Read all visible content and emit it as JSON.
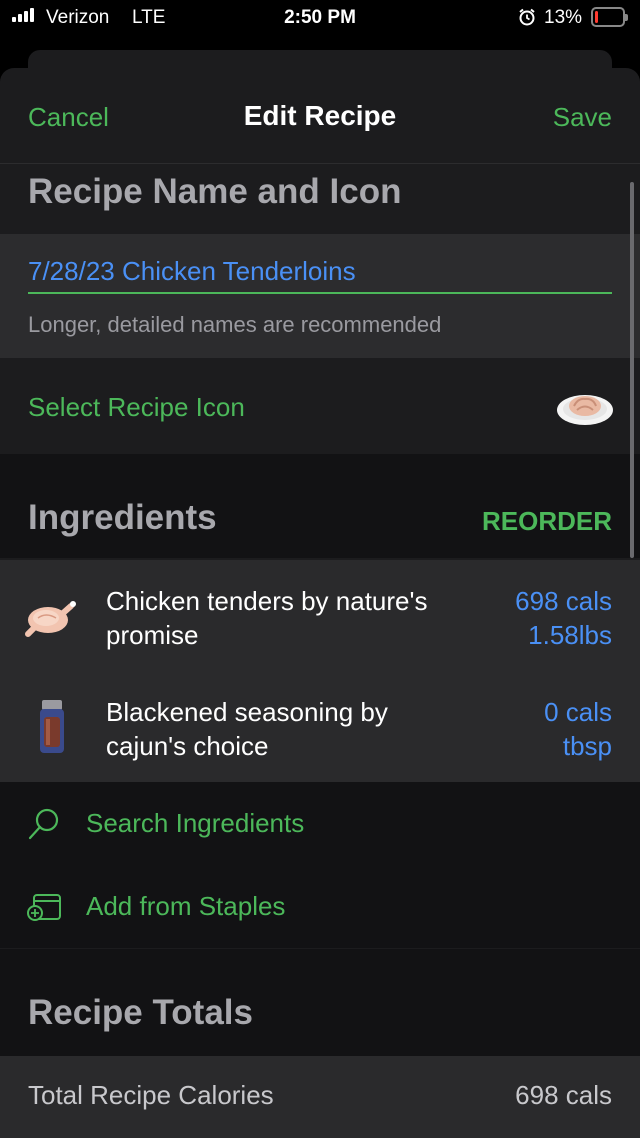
{
  "status_bar": {
    "carrier": "Verizon",
    "network": "LTE",
    "time": "2:50 PM",
    "battery_percent": "13%",
    "battery_level": 0.13,
    "alarm_icon": "alarm-clock-icon",
    "battery_color": "#ff3b30"
  },
  "nav": {
    "cancel_label": "Cancel",
    "title": "Edit Recipe",
    "save_label": "Save"
  },
  "recipe_name_section": {
    "heading": "Recipe Name and Icon",
    "name_value": "7/28/23 Chicken Tenderloins",
    "hint": "Longer, detailed names are recommended",
    "select_icon_label": "Select Recipe Icon",
    "icon": "chicken-plate-icon"
  },
  "ingredients_section": {
    "heading": "Ingredients",
    "reorder_label": "REORDER",
    "items": [
      {
        "name": "Chicken tenders by nature's promise",
        "calories": "698 cals",
        "amount": "1.58lbs",
        "icon": "roast-chicken-icon"
      },
      {
        "name": "Blackened seasoning by cajun's choice",
        "calories": "0 cals",
        "amount": "tbsp",
        "icon": "spice-jar-icon"
      }
    ],
    "actions": [
      {
        "label": "Search Ingredients",
        "icon": "search-icon"
      },
      {
        "label": "Add from Staples",
        "icon": "staples-icon"
      }
    ]
  },
  "totals_section": {
    "heading": "Recipe Totals",
    "rows": [
      {
        "label": "Total Recipe Calories",
        "value": "698 cals"
      }
    ]
  },
  "colors": {
    "accent_green": "#4cb85a",
    "link_blue": "#4a90f5",
    "background": "#1c1c1e"
  }
}
